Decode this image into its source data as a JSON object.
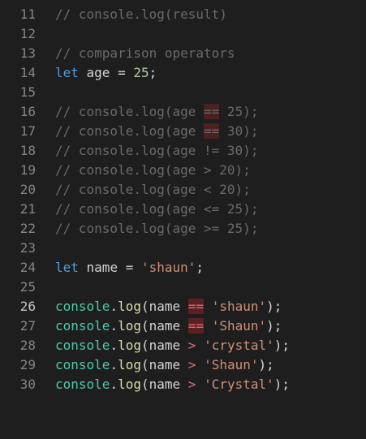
{
  "colors": {
    "background": "#1e1e1e",
    "line_number": "#858585",
    "comment": "#6a6a6a",
    "keyword": "#569cd6",
    "number": "#b5cea8",
    "string": "#ce9178",
    "object": "#4ec9b0",
    "method": "#dcdcaa",
    "operator_highlight": "#e06c75"
  },
  "editor": {
    "lines": [
      {
        "num": "11",
        "tokens": [
          {
            "t": "comment",
            "v": "// console.log(result)"
          }
        ]
      },
      {
        "num": "12",
        "tokens": []
      },
      {
        "num": "13",
        "tokens": [
          {
            "t": "comment",
            "v": "// comparison operators"
          }
        ]
      },
      {
        "num": "14",
        "tokens": [
          {
            "t": "kw",
            "v": "let"
          },
          {
            "t": "plain",
            "v": " age "
          },
          {
            "t": "op",
            "v": "="
          },
          {
            "t": "plain",
            "v": " "
          },
          {
            "t": "num",
            "v": "25"
          },
          {
            "t": "plain",
            "v": ";"
          }
        ]
      },
      {
        "num": "15",
        "tokens": []
      },
      {
        "num": "16",
        "tokens": [
          {
            "t": "comment",
            "v": "// console.log(age "
          },
          {
            "t": "comment",
            "v": "==",
            "hl": true
          },
          {
            "t": "comment",
            "v": " 25);"
          }
        ]
      },
      {
        "num": "17",
        "tokens": [
          {
            "t": "comment",
            "v": "// console.log(age "
          },
          {
            "t": "comment",
            "v": "==",
            "hl": true
          },
          {
            "t": "comment",
            "v": " 30);"
          }
        ]
      },
      {
        "num": "18",
        "tokens": [
          {
            "t": "comment",
            "v": "// console.log(age != 30);"
          }
        ]
      },
      {
        "num": "19",
        "tokens": [
          {
            "t": "comment",
            "v": "// console.log(age > 20);"
          }
        ]
      },
      {
        "num": "20",
        "tokens": [
          {
            "t": "comment",
            "v": "// console.log(age < 20);"
          }
        ]
      },
      {
        "num": "21",
        "tokens": [
          {
            "t": "comment",
            "v": "// console.log(age <= 25);"
          }
        ]
      },
      {
        "num": "22",
        "tokens": [
          {
            "t": "comment",
            "v": "// console.log(age >= 25);"
          }
        ]
      },
      {
        "num": "23",
        "tokens": []
      },
      {
        "num": "24",
        "tokens": [
          {
            "t": "kw",
            "v": "let"
          },
          {
            "t": "plain",
            "v": " name "
          },
          {
            "t": "op",
            "v": "="
          },
          {
            "t": "plain",
            "v": " "
          },
          {
            "t": "str",
            "v": "'shaun'"
          },
          {
            "t": "plain",
            "v": ";"
          }
        ]
      },
      {
        "num": "25",
        "tokens": []
      },
      {
        "num": "26",
        "active": true,
        "tokens": [
          {
            "t": "fn",
            "v": "console"
          },
          {
            "t": "plain",
            "v": "."
          },
          {
            "t": "method",
            "v": "log"
          },
          {
            "t": "plain",
            "v": "(name "
          },
          {
            "t": "cmp",
            "v": "==",
            "hl": true
          },
          {
            "t": "plain",
            "v": " "
          },
          {
            "t": "str",
            "v": "'shaun'"
          },
          {
            "t": "plain",
            "v": ");"
          }
        ]
      },
      {
        "num": "27",
        "tokens": [
          {
            "t": "fn",
            "v": "console"
          },
          {
            "t": "plain",
            "v": "."
          },
          {
            "t": "method",
            "v": "log"
          },
          {
            "t": "plain",
            "v": "(name "
          },
          {
            "t": "cmp",
            "v": "==",
            "hl": true
          },
          {
            "t": "plain",
            "v": " "
          },
          {
            "t": "str",
            "v": "'Shaun'"
          },
          {
            "t": "plain",
            "v": ");"
          }
        ]
      },
      {
        "num": "28",
        "tokens": [
          {
            "t": "fn",
            "v": "console"
          },
          {
            "t": "plain",
            "v": "."
          },
          {
            "t": "method",
            "v": "log"
          },
          {
            "t": "plain",
            "v": "(name "
          },
          {
            "t": "cmp",
            "v": ">"
          },
          {
            "t": "plain",
            "v": " "
          },
          {
            "t": "str",
            "v": "'crystal'"
          },
          {
            "t": "plain",
            "v": ");"
          }
        ]
      },
      {
        "num": "29",
        "tokens": [
          {
            "t": "fn",
            "v": "console"
          },
          {
            "t": "plain",
            "v": "."
          },
          {
            "t": "method",
            "v": "log"
          },
          {
            "t": "plain",
            "v": "(name "
          },
          {
            "t": "cmp",
            "v": ">"
          },
          {
            "t": "plain",
            "v": " "
          },
          {
            "t": "str",
            "v": "'Shaun'"
          },
          {
            "t": "plain",
            "v": ");"
          }
        ]
      },
      {
        "num": "30",
        "tokens": [
          {
            "t": "fn",
            "v": "console"
          },
          {
            "t": "plain",
            "v": "."
          },
          {
            "t": "method",
            "v": "log"
          },
          {
            "t": "plain",
            "v": "(name "
          },
          {
            "t": "cmp",
            "v": ">"
          },
          {
            "t": "plain",
            "v": " "
          },
          {
            "t": "str",
            "v": "'Crystal'"
          },
          {
            "t": "plain",
            "v": ");"
          }
        ]
      }
    ]
  }
}
